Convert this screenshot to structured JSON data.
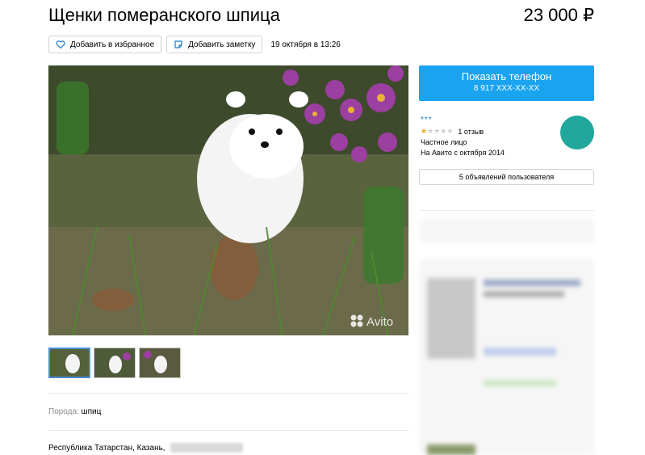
{
  "listing": {
    "title": "Щенки померанского шпица",
    "price": "23 000 ₽",
    "posted": "19 октября в 13:26"
  },
  "actions": {
    "favorite_label": "Добавить в избранное",
    "note_label": "Добавить заметку"
  },
  "photo": {
    "watermark": "Avito"
  },
  "thumbnails": [
    {
      "active": true
    },
    {
      "active": false
    },
    {
      "active": false
    }
  ],
  "params": {
    "breed_label": "Порода:",
    "breed_value": "шпиц"
  },
  "address": {
    "text": "Республика Татарстан, Казань,"
  },
  "contact": {
    "button_label": "Показать телефон",
    "phone_masked": "8 917 XXX-XX-XX"
  },
  "seller": {
    "name": "***",
    "reviews": "1 отзыв",
    "rating": 1,
    "rating_max": 5,
    "type": "Частное лицо",
    "since": "На Авито с октября 2014",
    "avatar_color": "#21a79b"
  },
  "user_ads_label": "5 объявлений пользователя",
  "colors": {
    "accent": "#1aa4f0",
    "link": "#1a7bd0",
    "star": "#f0a818"
  }
}
